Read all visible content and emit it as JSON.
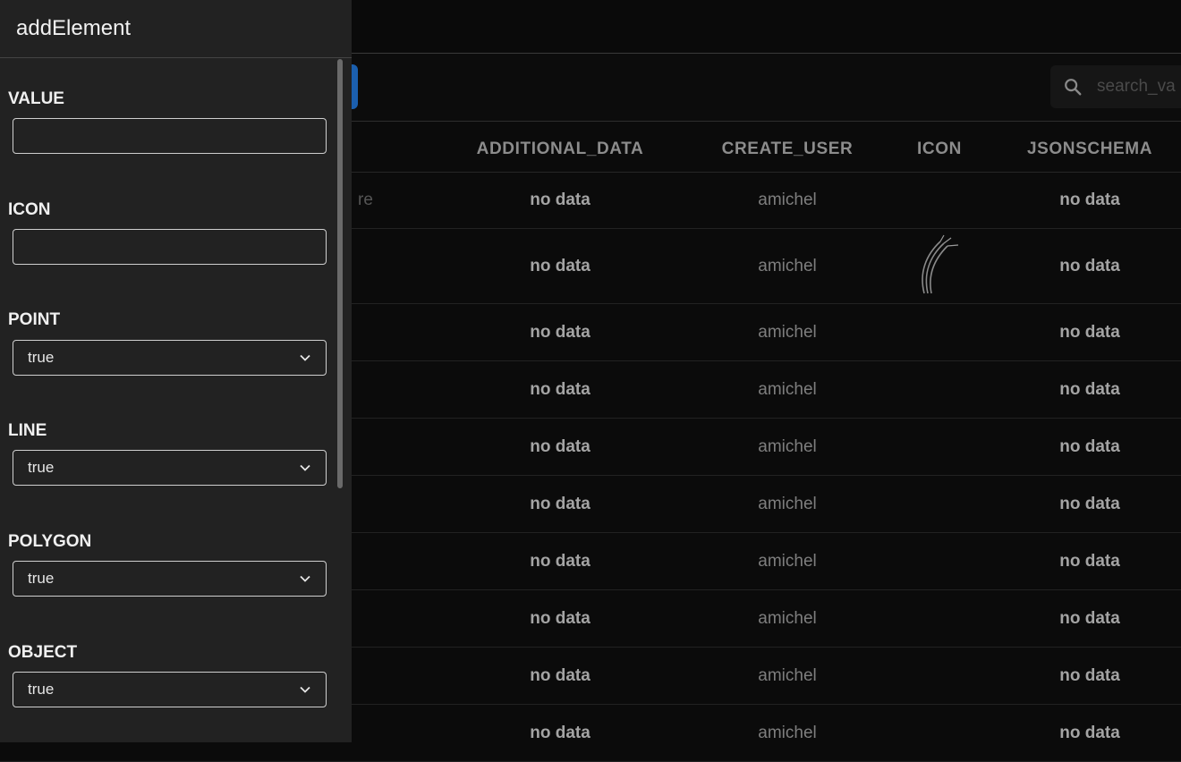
{
  "panel": {
    "title": "addElement",
    "fields": [
      {
        "label": "VALUE",
        "type": "text",
        "value": ""
      },
      {
        "label": "ICON",
        "type": "text",
        "value": ""
      },
      {
        "label": "POINT",
        "type": "select",
        "value": "true"
      },
      {
        "label": "LINE",
        "type": "select",
        "value": "true"
      },
      {
        "label": "POLYGON",
        "type": "select",
        "value": "true"
      },
      {
        "label": "OBJECT",
        "type": "select",
        "value": "true"
      }
    ]
  },
  "toolbar": {
    "search_placeholder": "search_va"
  },
  "table": {
    "columns": [
      "ADDITIONAL_DATA",
      "CREATE_USER",
      "ICON",
      "JSONSCHEMA"
    ],
    "first_row_partial": "re",
    "rows": [
      {
        "additional_data": "no data",
        "create_user": "amichel",
        "icon": "",
        "jsonschema": "no data"
      },
      {
        "additional_data": "no data",
        "create_user": "amichel",
        "icon": "cable-icon",
        "jsonschema": "no data"
      },
      {
        "additional_data": "no data",
        "create_user": "amichel",
        "icon": "",
        "jsonschema": "no data"
      },
      {
        "additional_data": "no data",
        "create_user": "amichel",
        "icon": "",
        "jsonschema": "no data"
      },
      {
        "additional_data": "no data",
        "create_user": "amichel",
        "icon": "",
        "jsonschema": "no data"
      },
      {
        "additional_data": "no data",
        "create_user": "amichel",
        "icon": "",
        "jsonschema": "no data"
      },
      {
        "additional_data": "no data",
        "create_user": "amichel",
        "icon": "",
        "jsonschema": "no data"
      },
      {
        "additional_data": "no data",
        "create_user": "amichel",
        "icon": "",
        "jsonschema": "no data"
      },
      {
        "additional_data": "no data",
        "create_user": "amichel",
        "icon": "",
        "jsonschema": "no data"
      },
      {
        "additional_data": "no data",
        "create_user": "amichel",
        "icon": "",
        "jsonschema": "no data"
      }
    ]
  }
}
